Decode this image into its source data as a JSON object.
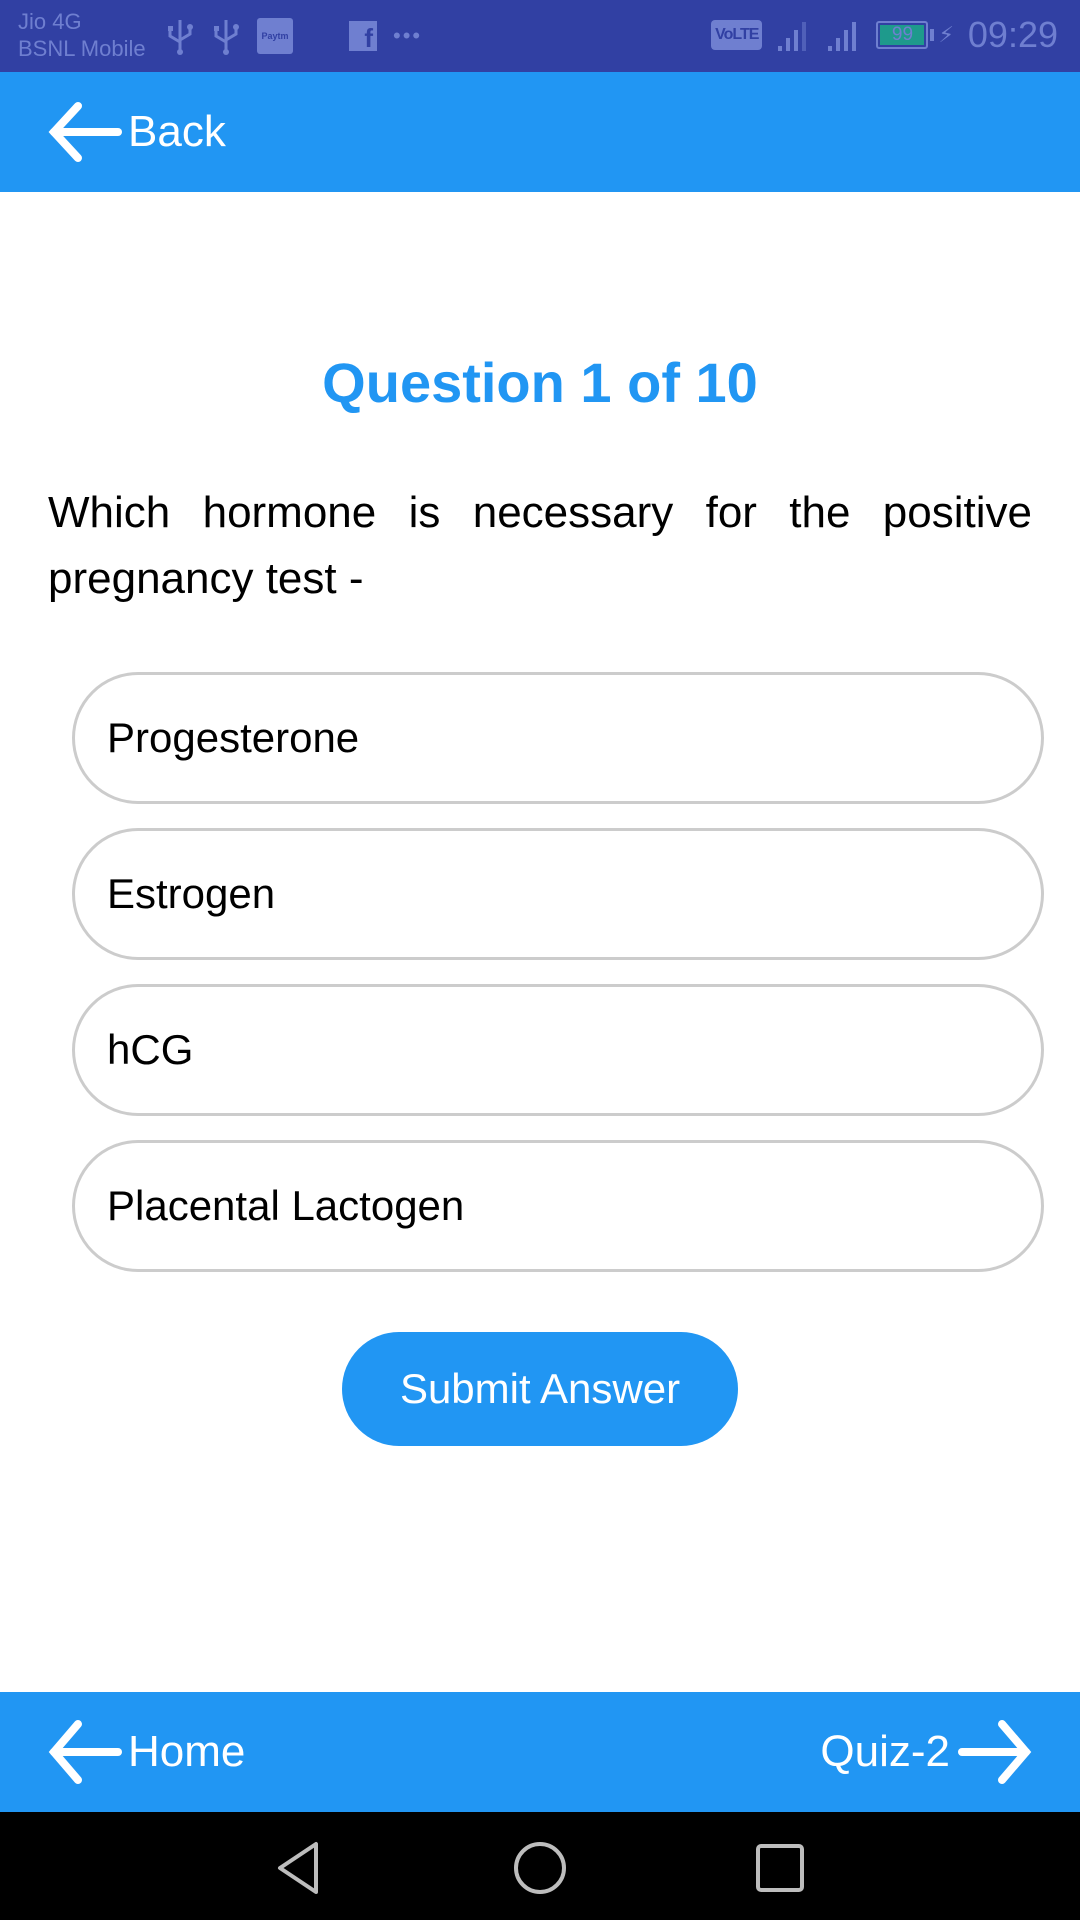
{
  "status_bar": {
    "carrier_1": "Jio 4G",
    "carrier_2": "BSNL Mobile",
    "notification_icons": [
      "usb-icon",
      "usb-icon",
      "paytm-icon",
      "facebook-icon",
      "more-dots-icon"
    ],
    "paytm_label": "Paytm",
    "facebook_label": "f",
    "more_label": "•••",
    "volte_label": "VoLTE",
    "battery_level": "99",
    "charging_symbol": "⚡",
    "time": "09:29",
    "colors": {
      "background": "#3140a3",
      "foreground": "#6f7fd0",
      "battery_fill": "#1e9a8c"
    }
  },
  "top_bar": {
    "back_label": "Back",
    "icon": "arrow-left-icon",
    "color": "#2196f3"
  },
  "quiz": {
    "title": "Question 1 of 10",
    "current_question": 1,
    "total_questions": 10,
    "question_text": "Which hormone is necessary for the positive pregnancy test -",
    "options": [
      {
        "label": "Progesterone"
      },
      {
        "label": "Estrogen"
      },
      {
        "label": "hCG"
      },
      {
        "label": "Placental Lactogen"
      }
    ],
    "submit_label": "Submit Answer",
    "accent_color": "#2196f3"
  },
  "bottom_bar": {
    "home_label": "Home",
    "next_label": "Quiz-2",
    "home_icon": "arrow-left-icon",
    "next_icon": "arrow-right-icon"
  },
  "system_nav": {
    "buttons": [
      "back-triangle-icon",
      "home-circle-icon",
      "recents-square-icon"
    ]
  }
}
